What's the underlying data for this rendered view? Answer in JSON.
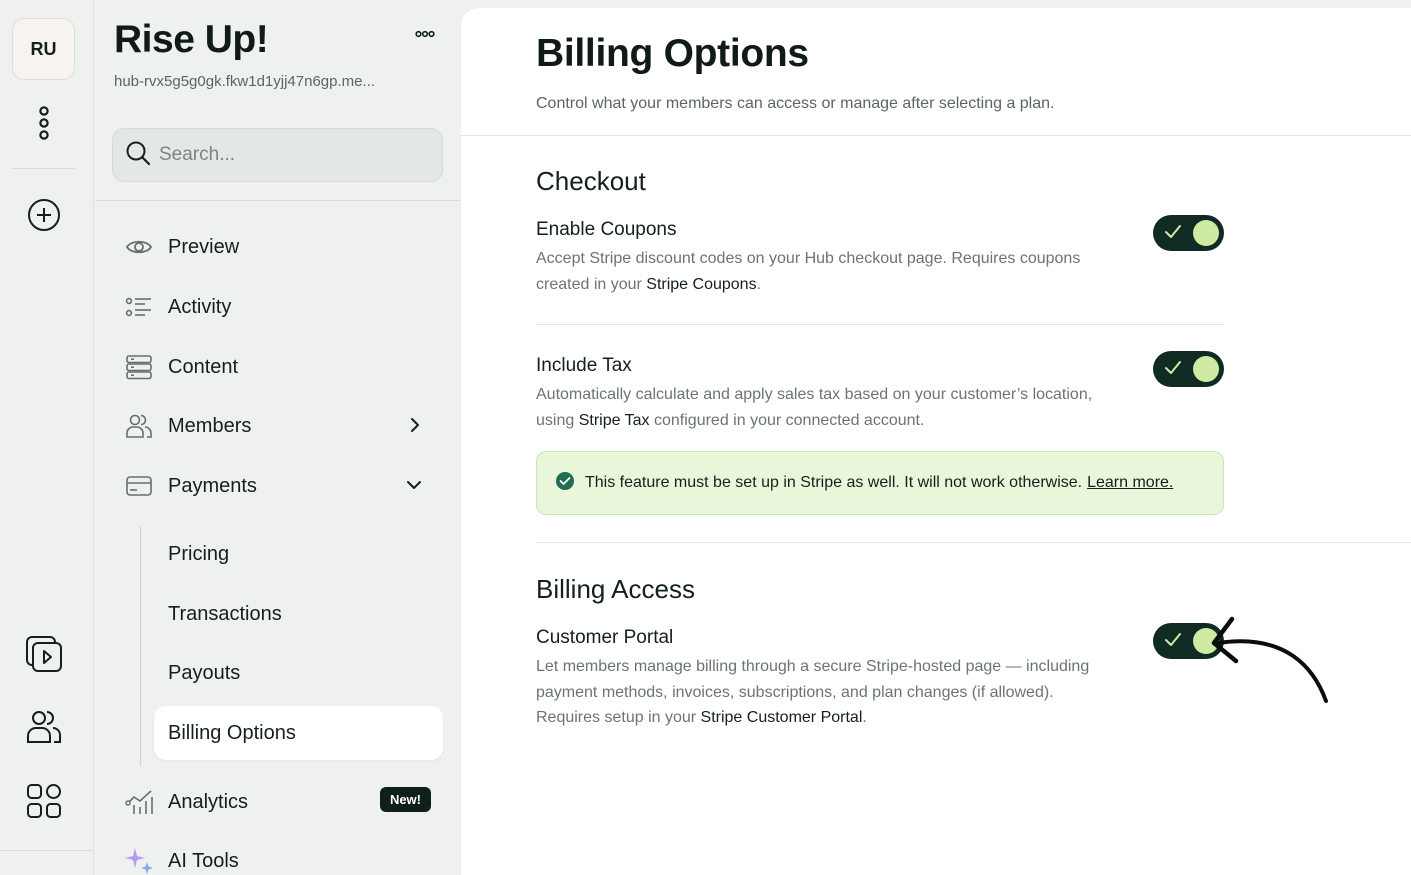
{
  "rail": {
    "avatar_initials": "RU",
    "icons": [
      "more-vertical-icon",
      "add-circle-icon",
      "video-library-icon",
      "users-icon",
      "apps-grid-icon"
    ]
  },
  "sidebar": {
    "title": "Rise Up!",
    "url": "hub-rvx5g5g0gk.fkw1d1yjj47n6gp.me...",
    "search_placeholder": "Search...",
    "items": [
      {
        "label": "Preview",
        "icon": "eye-icon"
      },
      {
        "label": "Activity",
        "icon": "activity-list-icon"
      },
      {
        "label": "Content",
        "icon": "content-stack-icon"
      },
      {
        "label": "Members",
        "icon": "members-icon"
      },
      {
        "label": "Payments",
        "icon": "credit-card-icon"
      }
    ],
    "payments_sub": [
      "Pricing",
      "Transactions",
      "Payouts",
      "Billing Options"
    ],
    "active_sub": "Billing Options",
    "analytics": {
      "label": "Analytics",
      "badge": "New!"
    },
    "ai_tools": {
      "label": "AI Tools"
    }
  },
  "main": {
    "title": "Billing Options",
    "subtitle": "Control what your members can access or manage after selecting a plan.",
    "checkout": {
      "heading": "Checkout",
      "coupons": {
        "title": "Enable Coupons",
        "desc_1": "Accept Stripe discount codes on your Hub checkout page. Requires coupons created in your ",
        "link": "Stripe Coupons",
        "desc_2": ".",
        "enabled": true
      },
      "tax": {
        "title": "Include Tax",
        "desc_1": "Automatically calculate and apply sales tax based on your customer’s location, using ",
        "link": "Stripe Tax",
        "desc_2": " configured in your connected account.",
        "enabled": true
      },
      "notice": {
        "text": "This feature must be set up in Stripe as well. It will not work otherwise.",
        "link": "Learn more."
      }
    },
    "billing_access": {
      "heading": "Billing Access",
      "portal": {
        "title": "Customer Portal",
        "desc_1": "Let members manage billing through a secure Stripe-hosted page — including payment methods, invoices, subscriptions, and plan changes (if allowed). Requires setup in your ",
        "link": "Stripe Customer Portal",
        "desc_2": ".",
        "enabled": true
      }
    }
  },
  "colors": {
    "toggle_track": "#0f2b24",
    "toggle_knob": "#cfeaa3",
    "notice_bg": "#eaf6d9",
    "badge_bg": "#0f1f1a"
  }
}
